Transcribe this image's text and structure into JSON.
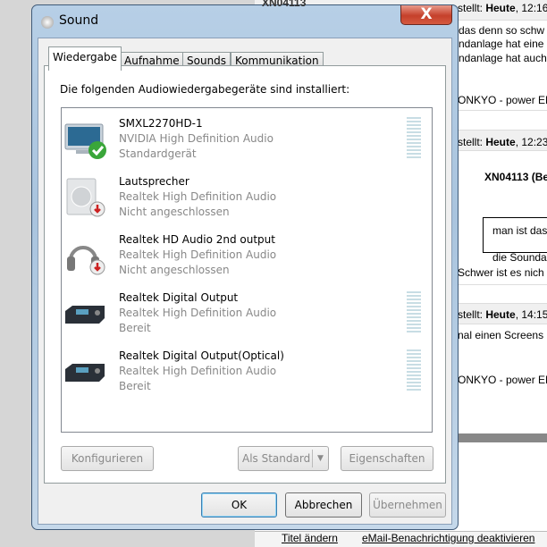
{
  "background_forum": {
    "top_user": "XN04113",
    "posts": [
      {
        "meta_prefix": "stellt: ",
        "meta_day": "Heute",
        "meta_time": ", 12:16",
        "lines": [
          "das denn so schw",
          "ndanlage hat eine",
          "ndanlage hat auch"
        ],
        "signature": "ONKYO - power EM"
      },
      {
        "meta_prefix": "stellt: ",
        "meta_day": "Heute",
        "meta_time": ", 12:23",
        "quote_user": "XN04113 (Be",
        "quote_lines": [
          "man ist das",
          "die Sounda"
        ],
        "lines": [
          "Schwer ist es nich"
        ]
      },
      {
        "meta_prefix": "stellt: ",
        "meta_day": "Heute",
        "meta_time": ", 14:15",
        "lines": [
          "nal einen Screens"
        ],
        "signature": "ONKYO - power EM"
      }
    ],
    "footer_links": [
      "Titel ändern",
      "eMail-Benachrichtigung deaktivieren"
    ]
  },
  "dialog": {
    "title": "Sound",
    "close_label": "X",
    "tabs": [
      "Wiedergabe",
      "Aufnahme",
      "Sounds",
      "Kommunikation"
    ],
    "active_tab": "Wiedergabe",
    "intro": "Die folgenden Audiowiedergabegeräte sind installiert:",
    "devices": [
      {
        "name": "SMXL2270HD-1",
        "driver": "NVIDIA High Definition Audio",
        "status": "Standardgerät",
        "icon": "monitor-icon",
        "badge": "check",
        "meter": true
      },
      {
        "name": "Lautsprecher",
        "driver": "Realtek High Definition Audio",
        "status": "Nicht angeschlossen",
        "icon": "speaker-icon",
        "badge": "unplugged",
        "meter": false
      },
      {
        "name": "Realtek HD Audio 2nd output",
        "driver": "Realtek High Definition Audio",
        "status": "Nicht angeschlossen",
        "icon": "headphones-icon",
        "badge": "unplugged",
        "meter": false
      },
      {
        "name": "Realtek Digital Output",
        "driver": "Realtek High Definition Audio",
        "status": "Bereit",
        "icon": "receiver-icon",
        "badge": "",
        "meter": true
      },
      {
        "name": "Realtek Digital Output(Optical)",
        "driver": "Realtek High Definition Audio",
        "status": "Bereit",
        "icon": "receiver-icon",
        "badge": "",
        "meter": true
      }
    ],
    "buttons": {
      "configure": "Konfigurieren",
      "set_default": "Als Standard",
      "properties": "Eigenschaften",
      "ok": "OK",
      "cancel": "Abbrechen",
      "apply": "Übernehmen"
    }
  }
}
